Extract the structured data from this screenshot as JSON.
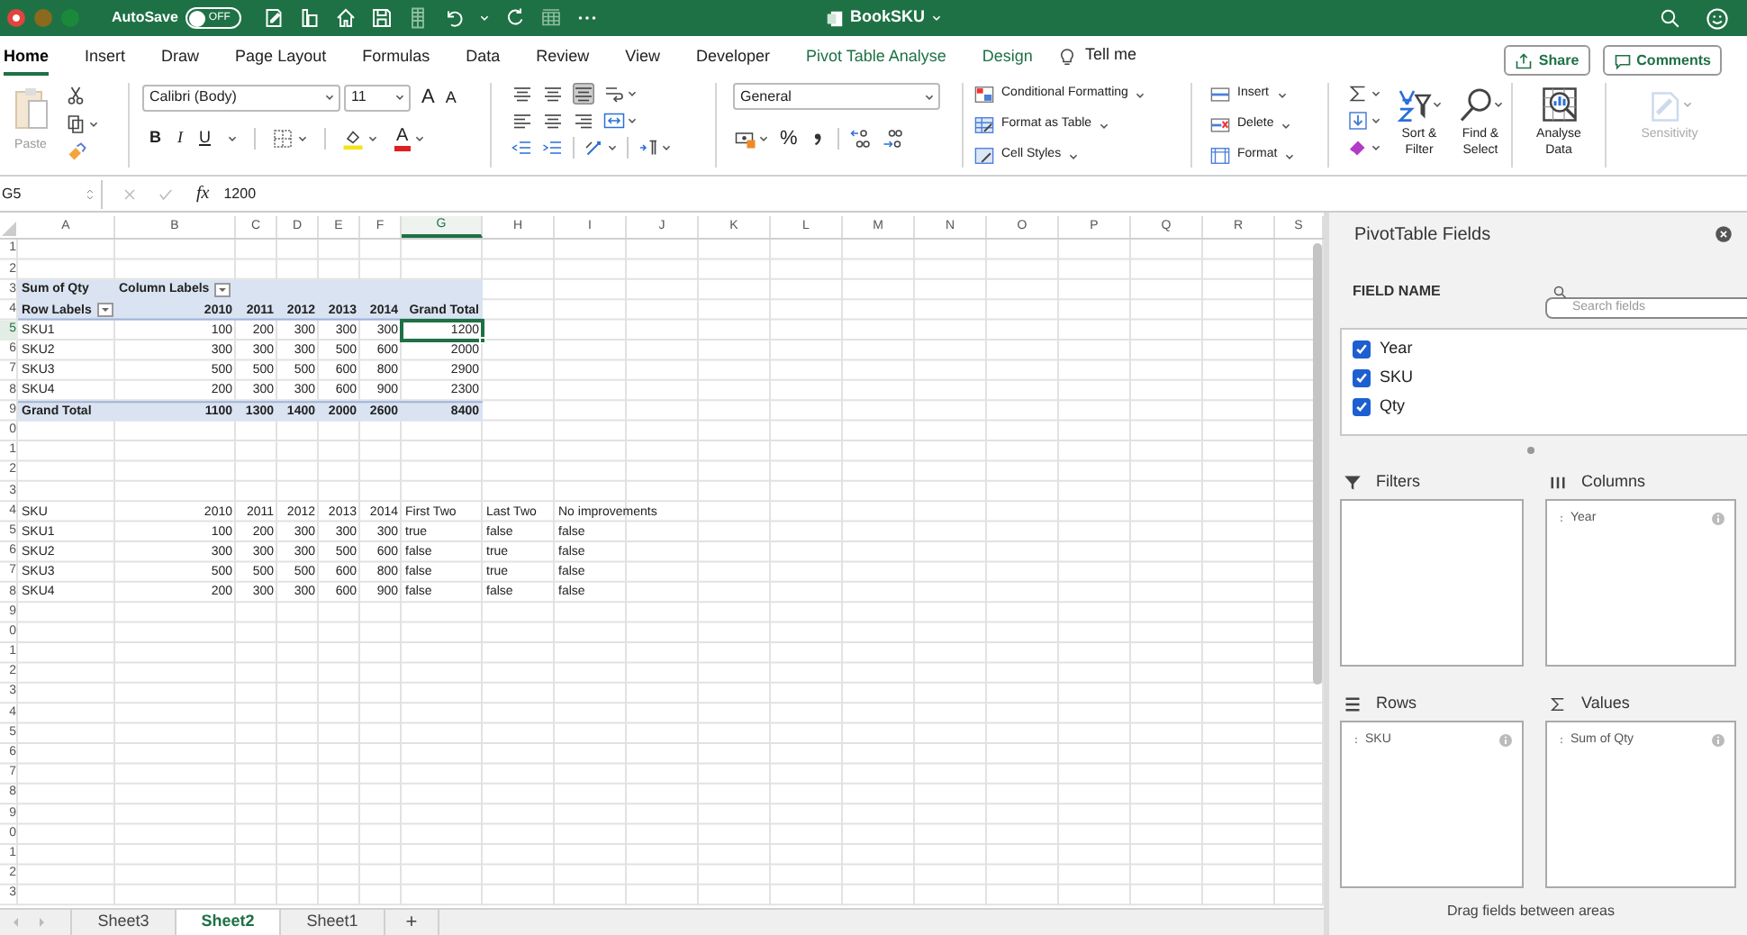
{
  "title_bar": {
    "autosave_label": "AutoSave",
    "autosave_toggle": {
      "label": "OFF",
      "on": false
    },
    "title": "BookSKU"
  },
  "ribbon_tabs": [
    {
      "label": "Home",
      "selected": true,
      "contextual": false
    },
    {
      "label": "Insert",
      "selected": false,
      "contextual": false
    },
    {
      "label": "Draw",
      "selected": false,
      "contextual": false
    },
    {
      "label": "Page Layout",
      "selected": false,
      "contextual": false
    },
    {
      "label": "Formulas",
      "selected": false,
      "contextual": false
    },
    {
      "label": "Data",
      "selected": false,
      "contextual": false
    },
    {
      "label": "Review",
      "selected": false,
      "contextual": false
    },
    {
      "label": "View",
      "selected": false,
      "contextual": false
    },
    {
      "label": "Developer",
      "selected": false,
      "contextual": false
    },
    {
      "label": "Pivot Table Analyse",
      "selected": false,
      "contextual": true
    },
    {
      "label": "Design",
      "selected": false,
      "contextual": true
    }
  ],
  "tell_me": "Tell me",
  "share_button": "Share",
  "comments_button": "Comments",
  "ribbon": {
    "paste_label": "Paste",
    "font_name": "Calibri (Body)",
    "font_size": "11",
    "size_buttons": [
      "A",
      "A"
    ],
    "font_buttons": [
      "B",
      "I",
      "U"
    ],
    "font_color_glyph": "A",
    "number_format": "General",
    "percent_button": "%",
    "style_buttons": [
      "Conditional Formatting",
      "Format as Table",
      "Cell Styles"
    ],
    "cell_buttons": [
      "Insert",
      "Delete",
      "Format"
    ],
    "large_buttons": [
      {
        "kind": "sort",
        "lines": [
          "Sort &",
          "Filter"
        ],
        "disabled": false
      },
      {
        "kind": "find",
        "lines": [
          "Find &",
          "Select"
        ],
        "disabled": false
      },
      {
        "kind": "analyse",
        "lines": [
          "Analyse",
          "Data"
        ],
        "disabled": false
      },
      {
        "kind": "sensitivity",
        "lines": [
          "Sensitivity"
        ],
        "disabled": true
      }
    ]
  },
  "formula_bar": {
    "name_box": "G5",
    "fx_label": "fx",
    "formula": "1200"
  },
  "sheet": {
    "columns": [
      {
        "label": "A",
        "selected": false
      },
      {
        "label": "B",
        "selected": false
      },
      {
        "label": "C",
        "selected": false
      },
      {
        "label": "D",
        "selected": false
      },
      {
        "label": "E",
        "selected": false
      },
      {
        "label": "F",
        "selected": false
      },
      {
        "label": "G",
        "selected": true
      },
      {
        "label": "H",
        "selected": false
      },
      {
        "label": "I",
        "selected": false
      },
      {
        "label": "J",
        "selected": false
      },
      {
        "label": "K",
        "selected": false
      },
      {
        "label": "L",
        "selected": false
      },
      {
        "label": "M",
        "selected": false
      },
      {
        "label": "N",
        "selected": false
      },
      {
        "label": "O",
        "selected": false
      },
      {
        "label": "P",
        "selected": false
      },
      {
        "label": "Q",
        "selected": false
      },
      {
        "label": "R",
        "selected": false
      },
      {
        "label": "S",
        "selected": false
      }
    ],
    "row_headers": [
      {
        "label": "1",
        "selected": false
      },
      {
        "label": "2",
        "selected": false
      },
      {
        "label": "3",
        "selected": false
      },
      {
        "label": "4",
        "selected": false
      },
      {
        "label": "5",
        "selected": true
      },
      {
        "label": "6",
        "selected": false
      },
      {
        "label": "7",
        "selected": false
      },
      {
        "label": "8",
        "selected": false
      },
      {
        "label": "9",
        "selected": false
      },
      {
        "label": "0",
        "selected": false
      },
      {
        "label": "1",
        "selected": false
      },
      {
        "label": "2",
        "selected": false
      },
      {
        "label": "3",
        "selected": false
      },
      {
        "label": "4",
        "selected": false
      },
      {
        "label": "5",
        "selected": false
      },
      {
        "label": "6",
        "selected": false
      },
      {
        "label": "7",
        "selected": false
      },
      {
        "label": "8",
        "selected": false
      },
      {
        "label": "9",
        "selected": false
      },
      {
        "label": "0",
        "selected": false
      },
      {
        "label": "1",
        "selected": false
      },
      {
        "label": "2",
        "selected": false
      },
      {
        "label": "3",
        "selected": false
      },
      {
        "label": "4",
        "selected": false
      },
      {
        "label": "5",
        "selected": false
      },
      {
        "label": "6",
        "selected": false
      },
      {
        "label": "7",
        "selected": false
      },
      {
        "label": "8",
        "selected": false
      },
      {
        "label": "9",
        "selected": false
      },
      {
        "label": "0",
        "selected": false
      },
      {
        "label": "1",
        "selected": false
      },
      {
        "label": "2",
        "selected": false
      },
      {
        "label": "3",
        "selected": false
      }
    ],
    "pivot_table": {
      "corner": "Sum of Qty",
      "column_labels": "Column Labels",
      "row_labels": "Row Labels",
      "years": [
        "2010",
        "2011",
        "2012",
        "2013",
        "2014"
      ],
      "grand_total_header": "Grand Total",
      "rows": [
        {
          "label": "SKU1",
          "values": [
            "100",
            "200",
            "300",
            "300",
            "300"
          ],
          "total": "1200",
          "total_selected": true
        },
        {
          "label": "SKU2",
          "values": [
            "300",
            "300",
            "300",
            "500",
            "600"
          ],
          "total": "2000",
          "total_selected": false
        },
        {
          "label": "SKU3",
          "values": [
            "500",
            "500",
            "500",
            "600",
            "800"
          ],
          "total": "2900",
          "total_selected": false
        },
        {
          "label": "SKU4",
          "values": [
            "200",
            "300",
            "300",
            "600",
            "900"
          ],
          "total": "2300",
          "total_selected": false
        }
      ],
      "grand_total": {
        "label": "Grand Total",
        "values": [
          "1100",
          "1300",
          "1400",
          "2000",
          "2600"
        ],
        "total": "8400"
      }
    },
    "data_table": {
      "columns": [
        "SKU",
        "2010",
        "2011",
        "2012",
        "2013",
        "2014",
        "First Two",
        "Last Two",
        "No improvements"
      ],
      "rows": [
        [
          "SKU1",
          "100",
          "200",
          "300",
          "300",
          "300",
          "true",
          "false",
          "false"
        ],
        [
          "SKU2",
          "300",
          "300",
          "300",
          "500",
          "600",
          "false",
          "true",
          "false"
        ],
        [
          "SKU3",
          "500",
          "500",
          "500",
          "600",
          "800",
          "false",
          "true",
          "false"
        ],
        [
          "SKU4",
          "200",
          "300",
          "300",
          "600",
          "900",
          "false",
          "false",
          "false"
        ]
      ]
    }
  },
  "sheet_tabs": [
    {
      "label": "Sheet3",
      "selected": false
    },
    {
      "label": "Sheet2",
      "selected": true
    },
    {
      "label": "Sheet1",
      "selected": false
    }
  ],
  "add_sheet": "+",
  "pivot_panel": {
    "title": "PivotTable Fields",
    "field_header": "FIELD NAME",
    "search": {
      "placeholder": "Search fields"
    },
    "fields": [
      {
        "label": "Year",
        "checked": true
      },
      {
        "label": "SKU",
        "checked": true
      },
      {
        "label": "Qty",
        "checked": true
      }
    ],
    "areas": [
      {
        "kind": "filters",
        "label": "Filters"
      },
      {
        "kind": "columns",
        "label": "Columns",
        "items": [
          "Year"
        ]
      },
      {
        "kind": "rows",
        "label": "Rows",
        "items": [
          "SKU"
        ]
      },
      {
        "kind": "values",
        "label": "Values",
        "items": [
          "Sum of Qty"
        ]
      }
    ],
    "hint": "Drag fields between areas"
  }
}
